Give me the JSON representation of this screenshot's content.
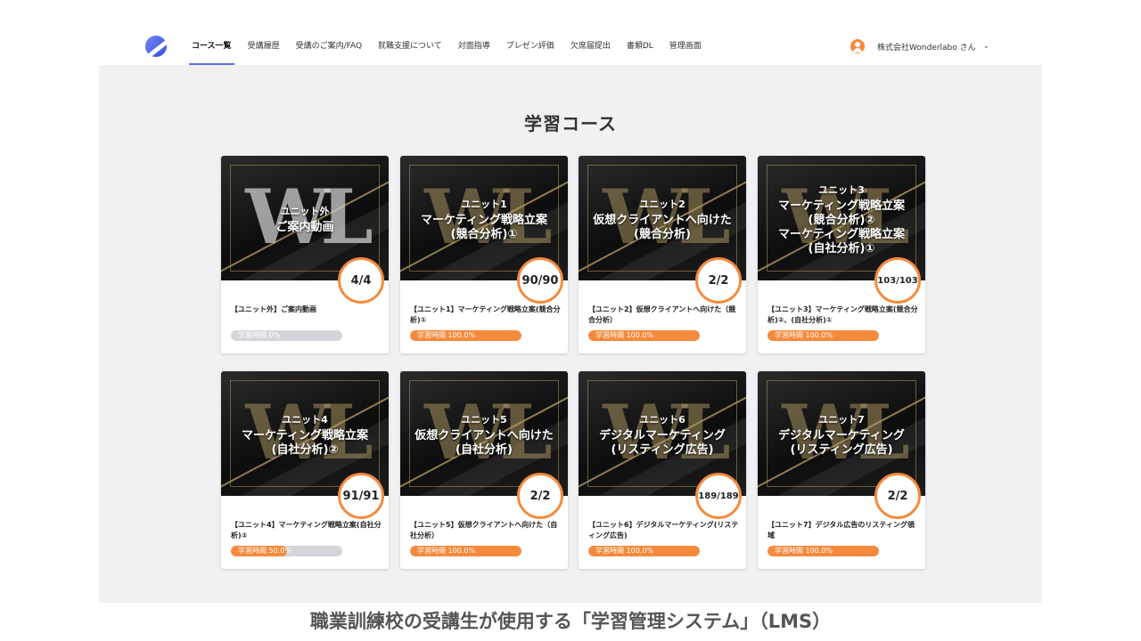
{
  "nav": {
    "items": [
      {
        "label": "コース一覧",
        "active": true
      },
      {
        "label": "受講履歴"
      },
      {
        "label": "受講のご案内/FAQ"
      },
      {
        "label": "就職支援について"
      },
      {
        "label": "対面指導"
      },
      {
        "label": "プレゼン評価"
      },
      {
        "label": "欠席届提出"
      },
      {
        "label": "書類DL"
      },
      {
        "label": "管理画面"
      }
    ],
    "user_name": "株式会社Wonderlabo さん",
    "chevron": "⌄"
  },
  "main": {
    "title": "学習コース",
    "cards": [
      {
        "unit": "ユニット外",
        "caption": "ご案内動画",
        "badge": "4/4",
        "title": "【ユニット外】ご案内動画",
        "progress_label": "学習時間  0%",
        "progress": 0,
        "logo": "silver"
      },
      {
        "unit": "ユニット1",
        "caption": "マーケティング戦略立案\n(競合分析)①",
        "badge": "90/90",
        "title": "【ユニット1】マーケティング戦略立案(競合分析)①",
        "progress_label": "学習時間  100.0%",
        "progress": 100
      },
      {
        "unit": "ユニット2",
        "caption": "仮想クライアントへ向けた\n(競合分析)",
        "badge": "2/2",
        "title": "【ユニット2】仮想クライアントへ向けた（競合分析）",
        "progress_label": "学習時間  100.0%",
        "progress": 100
      },
      {
        "unit": "ユニット3",
        "caption": "マーケティング戦略立案\n(競合分析)②\nマーケティング戦略立案\n(自社分析)①",
        "badge": "103/103",
        "title": "【ユニット3】マーケティング戦略立案(競合分析)②、(自社分析)①",
        "progress_label": "学習時間  100.0%",
        "progress": 100
      },
      {
        "unit": "ユニット4",
        "caption": "マーケティング戦略立案\n(自社分析)②",
        "badge": "91/91",
        "title": "【ユニット4】マーケティング戦略立案(自社分析)②",
        "progress_label": "学習時間  50.0%",
        "progress": 50
      },
      {
        "unit": "ユニット5",
        "caption": "仮想クライアントへ向けた\n(自社分析)",
        "badge": "2/2",
        "title": "【ユニット5】仮想クライアントへ向けた（自社分析）",
        "progress_label": "学習時間  100.0%",
        "progress": 100
      },
      {
        "unit": "ユニット6",
        "caption": "デジタルマーケティング\n(リスティング広告)",
        "badge": "189/189",
        "title": "【ユニット6】デジタルマーケティング(リスティング広告)",
        "progress_label": "学習時間  100.0%",
        "progress": 100
      },
      {
        "unit": "ユニット7",
        "caption": "デジタルマーケティング\n(リスティング広告)",
        "badge": "2/2",
        "title": "【ユニット7】デジタル広告のリスティング領域",
        "progress_label": "学習時間  100.0%",
        "progress": 100
      }
    ]
  },
  "footer": {
    "caption": "職業訓練校の受講生が使用する「学習管理システム」（LMS）"
  },
  "colors": {
    "accent": "#f68a3c",
    "nav_active": "#5b6fe0",
    "background": "#f1f1f3"
  }
}
